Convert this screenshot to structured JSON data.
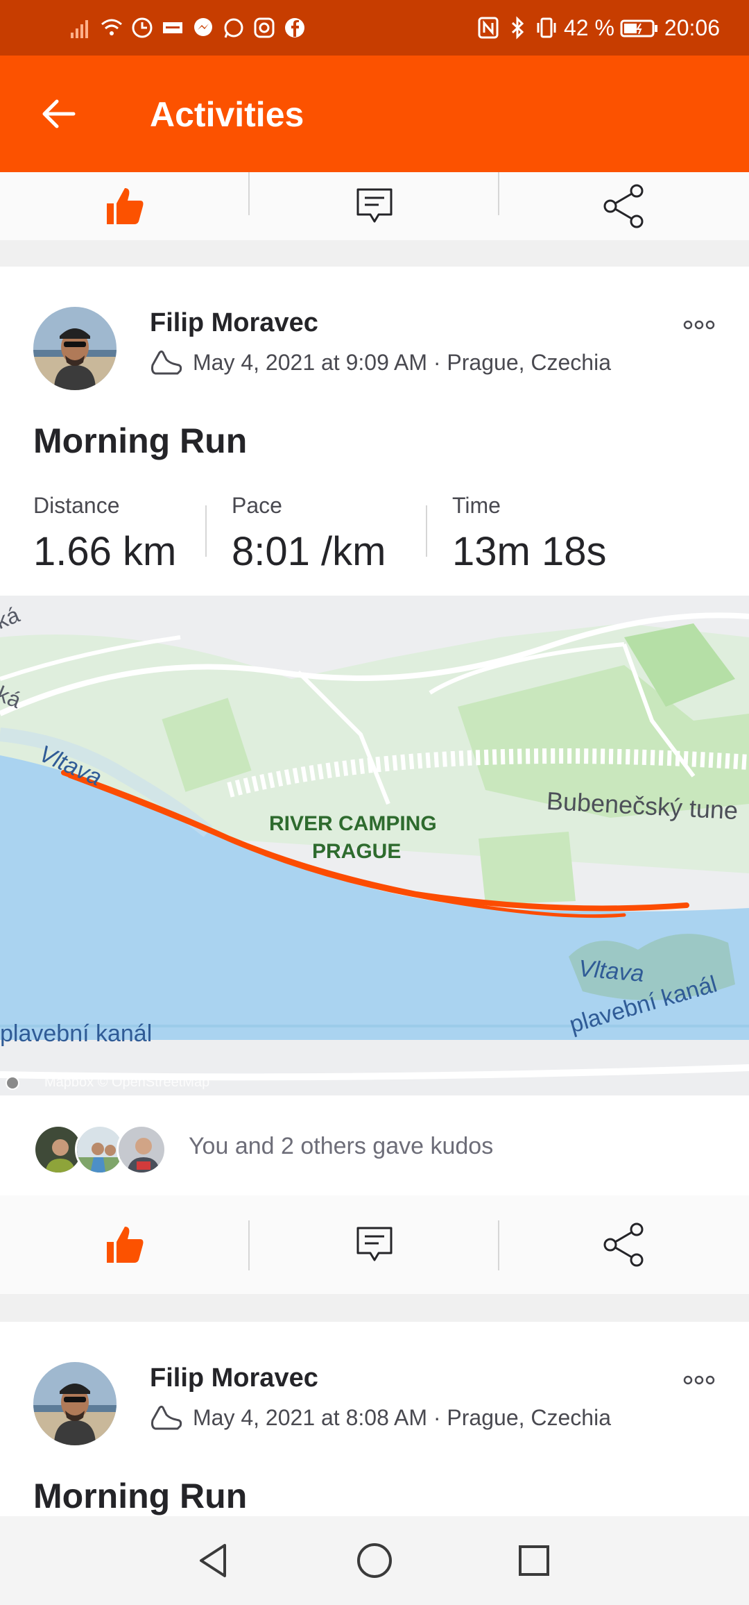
{
  "status_bar": {
    "battery_text": "42 %",
    "time": "20:06",
    "icons_left": [
      "signal-icon",
      "wifi-icon",
      "data-saver-icon",
      "sonos-icon",
      "messenger-icon",
      "whatsapp-icon",
      "instagram-icon",
      "facebook-icon"
    ],
    "icons_right": [
      "nfc-icon",
      "bluetooth-icon",
      "vibrate-icon",
      "battery-icon"
    ]
  },
  "app_bar": {
    "title": "Activities"
  },
  "activities": [
    {
      "athlete": "Filip Moravec",
      "meta": "May 4, 2021 at 9:09 AM · Prague, Czechia",
      "title": "Morning Run",
      "stats": [
        {
          "label": "Distance",
          "value": "1.66 km"
        },
        {
          "label": "Pace",
          "value": "8:01 /km"
        },
        {
          "label": "Time",
          "value": "13m 18s"
        }
      ],
      "map": {
        "labels": [
          "ká",
          "ká",
          "Vltava",
          "RIVER CAMPING",
          "PRAGUE",
          "Bubenečský tune",
          "Vltava",
          "plavební kanál",
          "plavební kanál"
        ],
        "attribution": "Mapbox © OpenStreetMap"
      },
      "kudos_text": "You and 2 others gave kudos"
    },
    {
      "athlete": "Filip Moravec",
      "meta": "May 4, 2021 at 8:08 AM · Prague, Czechia",
      "title": "Morning Run"
    }
  ],
  "colors": {
    "brand": "#fc5200",
    "status_bar": "#c73d00",
    "route": "#fc4c02",
    "water": "#aad3f0",
    "park": "#c9e7bd"
  }
}
